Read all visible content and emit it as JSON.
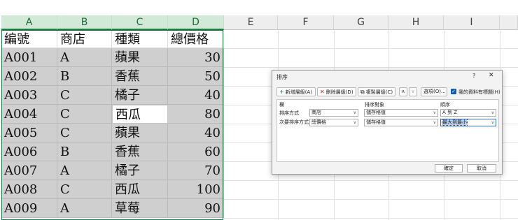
{
  "columns": [
    "A",
    "B",
    "C",
    "D",
    "E",
    "F",
    "G",
    "H",
    "I"
  ],
  "headers": [
    "編號",
    "商店",
    "種類",
    "總價格"
  ],
  "rows": [
    [
      "A001",
      "A",
      "蘋果",
      "30"
    ],
    [
      "A002",
      "B",
      "香蕉",
      "50"
    ],
    [
      "A003",
      "C",
      "橘子",
      "40"
    ],
    [
      "A004",
      "C",
      "西瓜",
      "80"
    ],
    [
      "A005",
      "C",
      "蘋果",
      "40"
    ],
    [
      "A006",
      "B",
      "香蕉",
      "60"
    ],
    [
      "A007",
      "A",
      "橘子",
      "70"
    ],
    [
      "A008",
      "C",
      "西瓜",
      "100"
    ],
    [
      "A009",
      "A",
      "草莓",
      "90"
    ]
  ],
  "dialog": {
    "title": "排序",
    "help": "?",
    "close": "✕",
    "add_level": "新增層級(A)",
    "delete_level": "刪除層級(D)",
    "copy_level": "複製層級(C)",
    "move_up": "∧",
    "move_down": "∨",
    "options": "選項(O)...",
    "has_headers": "我的資料有標題(H)",
    "col_header": "欄",
    "sort_on_header": "排序對象",
    "order_header": "順序",
    "levels": [
      {
        "label": "排序方式",
        "column": "商店",
        "sort_on": "儲存格值",
        "order": "A 到 Z"
      },
      {
        "label": "次要排序方式",
        "column": "總價格",
        "sort_on": "儲存格值",
        "order": "最大到最小"
      }
    ],
    "ok": "確定",
    "cancel": "取消"
  }
}
